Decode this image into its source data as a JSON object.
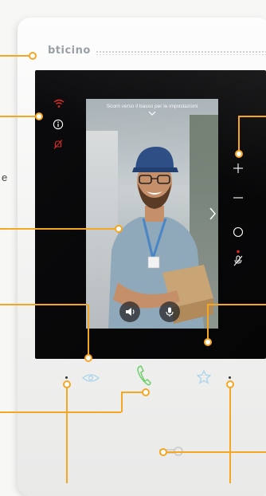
{
  "device": {
    "brand_label": "bticino",
    "edge_text": "e"
  },
  "video": {
    "hint_text": "Scorri verso il basso per le impostazioni",
    "buttons": [
      {
        "name": "speaker-volume-button",
        "icon": "speaker-icon"
      },
      {
        "name": "microphone-button",
        "icon": "microphone-icon"
      }
    ]
  },
  "status_icons": [
    {
      "name": "wifi-icon",
      "color": "#e02828"
    },
    {
      "name": "info-icon",
      "color": "#ffffff"
    },
    {
      "name": "bell-muted-icon",
      "color": "#e02828"
    }
  ],
  "side_controls": [
    {
      "name": "volume-up-icon"
    },
    {
      "name": "volume-down-icon"
    },
    {
      "name": "home-circle-icon"
    },
    {
      "name": "mic-mute-icon",
      "indicator_color": "#e02828"
    }
  ],
  "bottom_keys": [
    {
      "name": "eye-key-icon",
      "color": "#a8d4ec"
    },
    {
      "name": "handset-key-icon",
      "color": "#6fcf6a"
    },
    {
      "name": "star-key-icon",
      "color": "#a8d4ec"
    },
    {
      "name": "door-key-icon",
      "color": "#c9c9c9"
    }
  ],
  "colors": {
    "callout": "#f5a623",
    "accent_red": "#e02828",
    "accent_green": "#6fcf6a",
    "accent_blue": "#a8d4ec"
  }
}
